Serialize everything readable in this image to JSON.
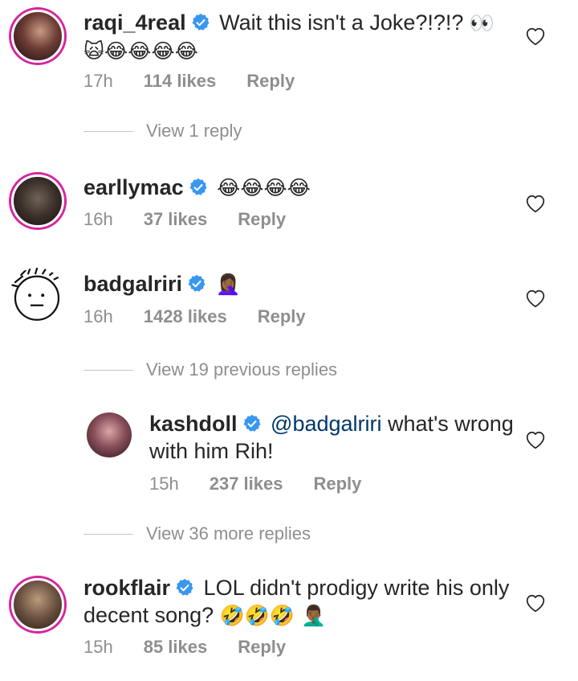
{
  "comments": [
    {
      "username": "raqi_4real",
      "text": "Wait this isn't a Joke?!?!?",
      "emoji": "👀",
      "emoji2": "🙀😂😂😂😂",
      "time": "17h",
      "likes": "114 likes",
      "reply": "Reply",
      "view_replies": "View 1 reply"
    },
    {
      "username": "earllymac",
      "text": "",
      "emoji": "😂😂😂😂",
      "time": "16h",
      "likes": "37 likes",
      "reply": "Reply"
    },
    {
      "username": "badgalriri",
      "text": "",
      "emoji": "🤦🏾‍♀️",
      "time": "16h",
      "likes": "1428 likes",
      "reply": "Reply",
      "view_replies": "View 19 previous replies"
    },
    {
      "username": "kashdoll",
      "mention": "@badgalriri",
      "text": "what's wrong",
      "text_line2": "with him Rih!",
      "time": "15h",
      "likes": "237 likes",
      "reply": "Reply",
      "view_replies": "View 36 more replies"
    },
    {
      "username": "rookflair",
      "text": "LOL didn't prodigy write his only",
      "text_line2": "decent song?",
      "emoji": "🤣🤣🤣 🤦🏾‍♂️",
      "time": "15h",
      "likes": "85 likes",
      "reply": "Reply"
    }
  ],
  "colors": {
    "text": "#262626",
    "muted": "#8e8e8e",
    "verified": "#3897f0",
    "mention": "#00376b",
    "story_ring": "#d6249f"
  },
  "icons": {
    "verified": "verified-badge-icon",
    "like": "heart-outline-icon"
  }
}
